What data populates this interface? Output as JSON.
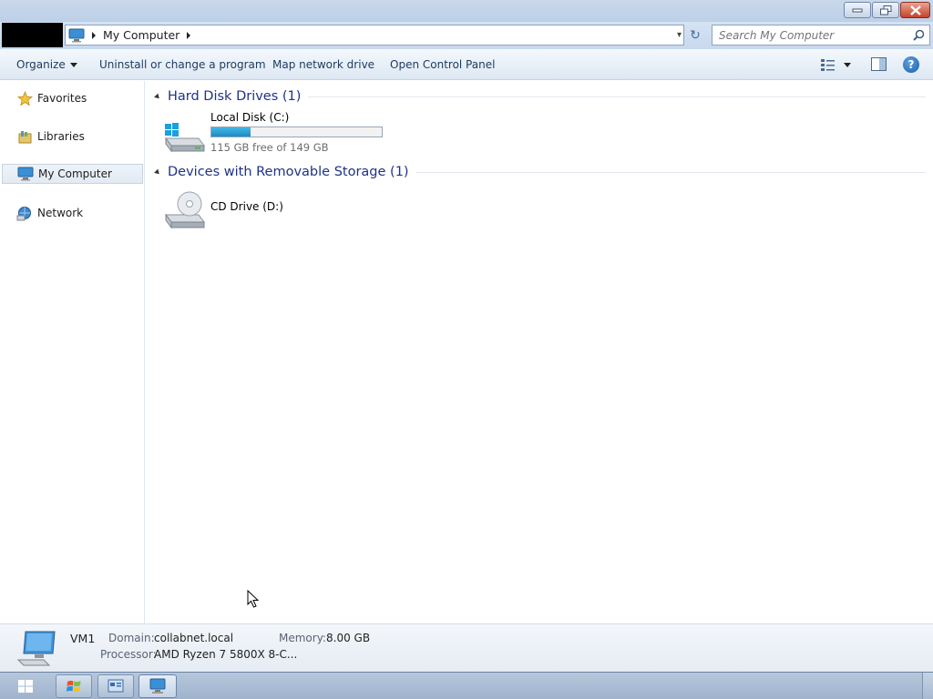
{
  "window": {
    "minimize_label": "Minimize",
    "maximize_label": "Restore",
    "close_label": "Close"
  },
  "address": {
    "location": "My Computer",
    "search_placeholder": "Search My Computer"
  },
  "toolbar": {
    "organize": "Organize",
    "uninstall": "Uninstall or change a program",
    "map_drive": "Map network drive",
    "control_panel": "Open Control Panel",
    "help": "?"
  },
  "nav": {
    "items": [
      {
        "label": "Favorites",
        "icon": "star-icon"
      },
      {
        "label": "Libraries",
        "icon": "library-icon"
      },
      {
        "label": "My Computer",
        "icon": "computer-icon",
        "selected": true
      },
      {
        "label": "Network",
        "icon": "network-icon"
      }
    ]
  },
  "groups": [
    {
      "title": "Hard Disk Drives (1)",
      "items": [
        {
          "name": "Local Disk (C:)",
          "free_text": "115 GB free of 149 GB",
          "used_fraction": 0.228,
          "icon": "hard-disk-icon"
        }
      ]
    },
    {
      "title": "Devices with Removable Storage (1)",
      "items": [
        {
          "name": "CD Drive (D:)",
          "icon": "cd-drive-icon"
        }
      ]
    }
  ],
  "details": {
    "name": "VM1",
    "domain_label": "Domain:",
    "domain_value": "collabnet.local",
    "memory_label": "Memory:",
    "memory_value": "8.00 GB",
    "processor_label": "Processor:",
    "processor_value": "AMD Ryzen 7 5800X 8-C..."
  },
  "colors": {
    "group_title": "#1e3287",
    "drive_bar": "#1b8bc4",
    "close_button": "#c7412a"
  }
}
